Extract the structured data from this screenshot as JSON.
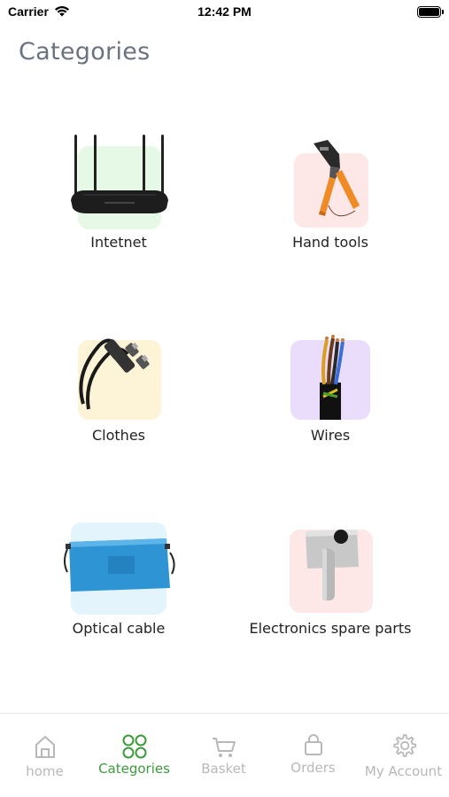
{
  "status_bar": {
    "carrier": "Carrier",
    "time": "12:42 PM"
  },
  "page": {
    "title": "Categories"
  },
  "categories": [
    {
      "label": "Intetnet",
      "icon": "router-image",
      "tile_color": "#e6f9e6"
    },
    {
      "label": "Hand tools",
      "icon": "crimping-tool-image",
      "tile_color": "#fde7e7"
    },
    {
      "label": "Clothes",
      "icon": "optical-cable-image",
      "tile_color": "#fdf3d6"
    },
    {
      "label": "Wires",
      "icon": "wires-image",
      "tile_color": "#eadcfb"
    },
    {
      "label": "Optical cable",
      "icon": "battery-image",
      "tile_color": "#e3f4fd"
    },
    {
      "label": "Electronics spare parts",
      "icon": "spare-part-image",
      "tile_color": "#fde7e7"
    }
  ],
  "tab_bar": {
    "active_color": "#3d9b3d",
    "inactive_color": "#b8b8b8",
    "tabs": [
      {
        "label": "home",
        "icon": "home-icon"
      },
      {
        "label": "Categories",
        "icon": "grid-icon"
      },
      {
        "label": "Basket",
        "icon": "cart-icon"
      },
      {
        "label": "Orders",
        "icon": "bag-icon"
      },
      {
        "label": "My Account",
        "icon": "gear-icon"
      }
    ]
  }
}
